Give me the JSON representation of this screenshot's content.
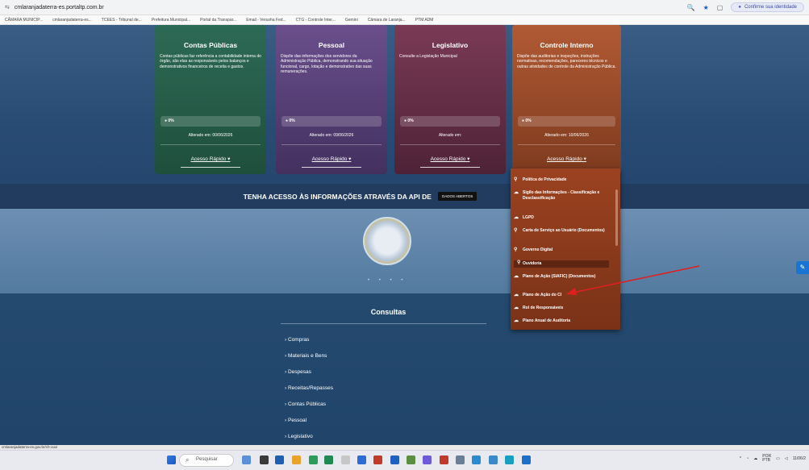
{
  "browser": {
    "url": "cmlaranjadaterra-es.portaltp.com.br",
    "profile_prompt": "Confirme sua identidade"
  },
  "bookmarks": [
    "CÂMARA MUNICIP...",
    "cmlaranjadaterra-es...",
    "TCEES - Tribunal de...",
    "Prefeitura Municipal...",
    "Portal da Transpar...",
    "Email - Verusha Fed...",
    "CTG - Controle Inter...",
    "Gemini",
    "Câmara de Laranja...",
    "PTM ADM"
  ],
  "cards": {
    "cp": {
      "title": "Contas Públicas",
      "desc": "Contas públicas faz referência a contabilidade interna do órgão, são elas as responsáveis pelos balanços e demonstrativos financeiros de receita e gastos.",
      "progress": "0%",
      "altered": "Alterado em: 00/06/2026",
      "quick": "Acesso Rápido"
    },
    "pe": {
      "title": "Pessoal",
      "desc": "Dispõe das informações dos servidores da Administração Pública, demonstrando sua situação funcional, cargo, lotação e demonstrativo das suas remunerações.",
      "progress": "0%",
      "altered": "Alterado em: 09/06/2026",
      "quick": "Acesso Rápido"
    },
    "le": {
      "title": "Legislativo",
      "desc": "Consulte a Legislação Municipal",
      "progress": "0%",
      "altered": "Alterado em:",
      "quick": "Acesso Rápido"
    },
    "ci": {
      "title": "Controle Interno",
      "desc": "Dispõe das auditorias e inspeções, instruções normativas, recomendações, pareceres técnicos e outras atividades de controle da Administração Pública.",
      "progress": "0%",
      "altered": "Alterado em: 10/06/2026",
      "quick": "Acesso Rápido"
    }
  },
  "api_band": {
    "text": "TENHA ACESSO ÀS INFORMAÇÕES ATRAVÉS DA API DE",
    "button": "DADOS ABERTOS"
  },
  "dropdown": [
    "Política de Privacidade",
    "Sigilo das Informações - Classificação e Desclassificação",
    "LGPD",
    "Carta de Serviço ao Usuário (Documentos)",
    "Governo Digital",
    "Ouvidoria",
    "Plano de Ação (SIAFIC) (Documentos)",
    "Plano de Ação do CI",
    "Rol de Responsáveis",
    "Plano Anual de Auditoria"
  ],
  "consultas": {
    "title": "Consultas",
    "items": [
      "Compras",
      "Materiais e Bens",
      "Despesas",
      "Receitas/Repasses",
      "Contas Públicas",
      "Pessoal",
      "Legislativo"
    ]
  },
  "status_url": "cmlaranjadaterra-es.gov.br/ch-ouvi",
  "taskbar": {
    "search": "Pesquisar",
    "lang": "POR",
    "layout": "PTB",
    "date": "11/06/2"
  },
  "colors": {
    "ci_card": "#b15a34",
    "menu": "#8a3a1b",
    "arrow": "#e02020",
    "taskbar": "#e8eaf0"
  }
}
